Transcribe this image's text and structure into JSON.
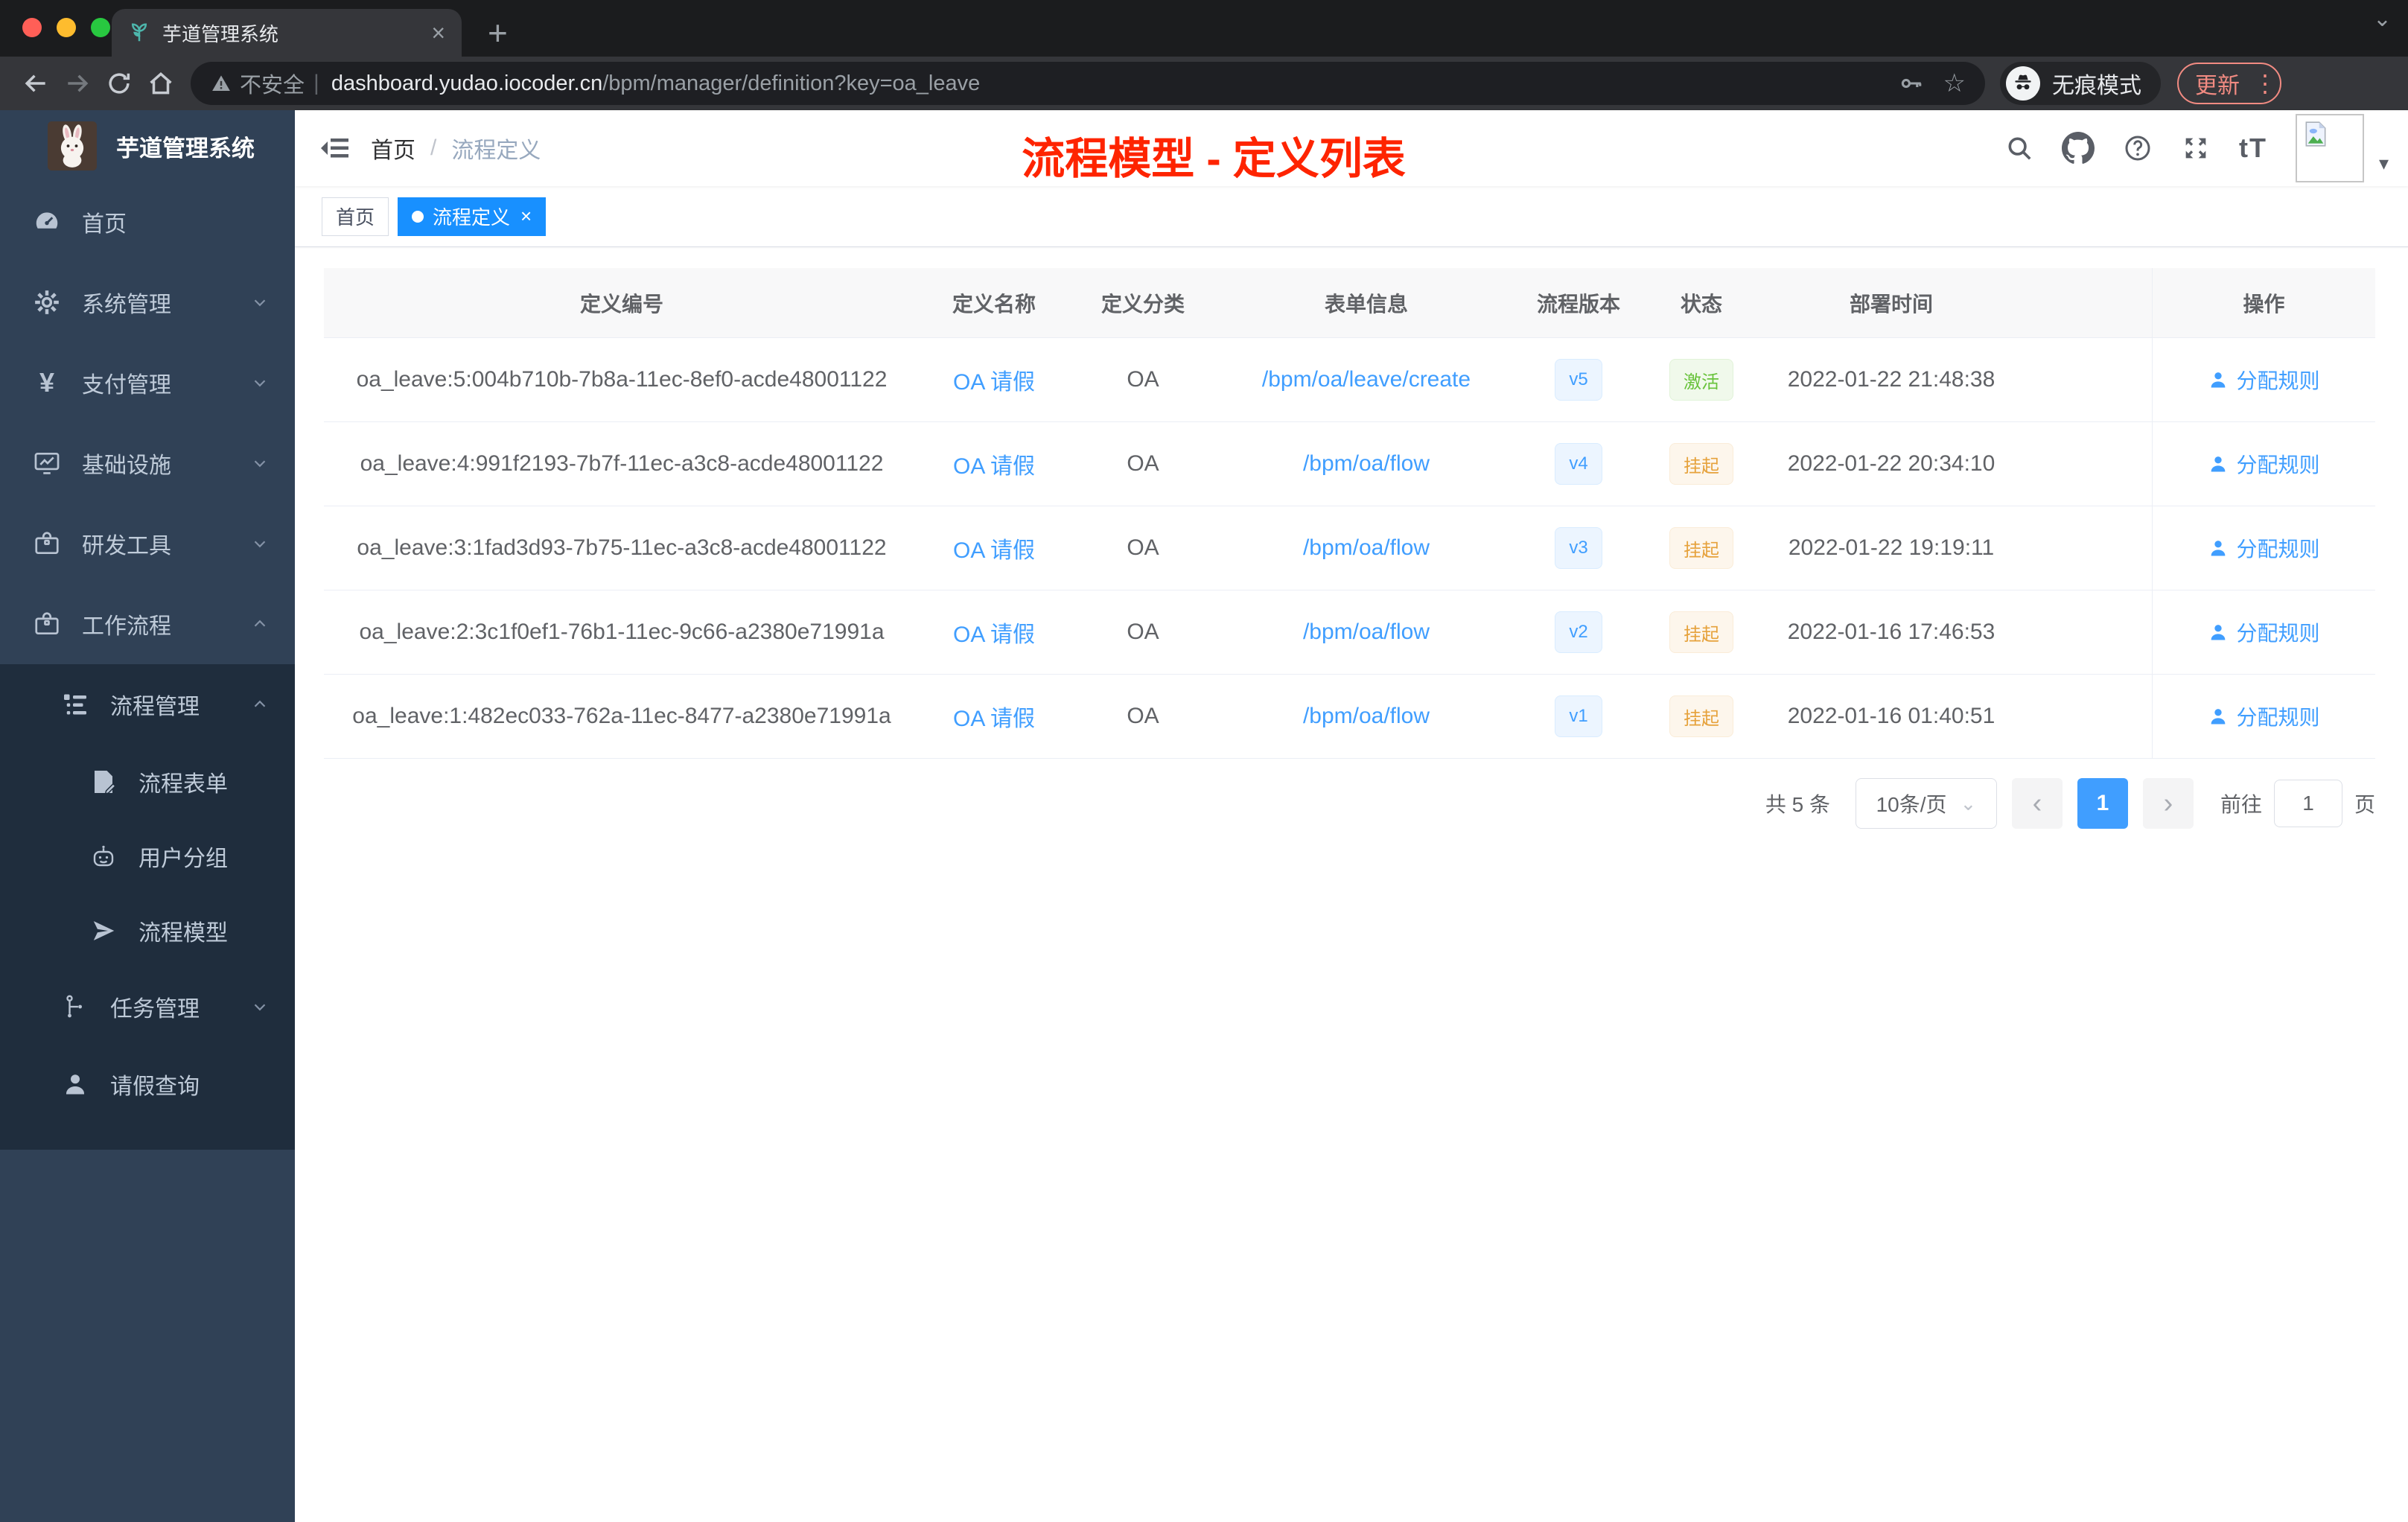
{
  "colors": {
    "primary_blue": "#409eff",
    "tag_active_blue": "#1890ff",
    "success_green": "#67c23a",
    "warning_orange": "#e6a23c",
    "annotation_red": "#fe2400",
    "sidebar_bg": "#304156",
    "submenu_bg": "#1f2d3d"
  },
  "icons": {
    "close_glyph": "×",
    "add_glyph": "+",
    "chevron_glyph": "⌄",
    "star_glyph": "☆",
    "kebab_glyph": "⋮",
    "caret_glyph": "▾",
    "prev_glyph": "‹",
    "next_glyph": "›",
    "divider_glyph": "|",
    "yuan_glyph": "¥",
    "text_size_glyph": "tT"
  },
  "browser": {
    "tab_title": "芋道管理系统",
    "security_label": "不安全",
    "url_host": "dashboard.yudao.iocoder.cn",
    "url_path": "/bpm/manager/definition?key=oa_leave",
    "incognito_label": "无痕模式",
    "update_label": "更新"
  },
  "sidebar": {
    "app_title": "芋道管理系统",
    "items": [
      {
        "label": "首页",
        "icon": "dashboard-icon"
      },
      {
        "label": "系统管理",
        "icon": "gear-icon"
      },
      {
        "label": "支付管理",
        "icon": "yuan-icon"
      },
      {
        "label": "基础设施",
        "icon": "monitor-icon"
      },
      {
        "label": "研发工具",
        "icon": "briefcase-icon"
      },
      {
        "label": "工作流程",
        "icon": "briefcase-icon"
      },
      {
        "label": "流程管理",
        "icon": "list-tree-icon"
      },
      {
        "label": "流程表单",
        "icon": "form-edit-icon"
      },
      {
        "label": "用户分组",
        "icon": "robot-icon"
      },
      {
        "label": "流程模型",
        "icon": "paper-plane-icon"
      },
      {
        "label": "任务管理",
        "icon": "tree-branch-icon"
      },
      {
        "label": "请假查询",
        "icon": "user-icon"
      }
    ]
  },
  "header": {
    "breadcrumb_home": "首页",
    "breadcrumb_separator": "/",
    "breadcrumb_current": "流程定义",
    "annotation": "流程模型 - 定义列表"
  },
  "tags": {
    "home_label": "首页",
    "active_label": "流程定义"
  },
  "table": {
    "columns": [
      "定义编号",
      "定义名称",
      "定义分类",
      "表单信息",
      "流程版本",
      "状态",
      "部署时间",
      "操作"
    ],
    "action_label": "分配规则",
    "rows": [
      {
        "id": "oa_leave:5:004b710b-7b8a-11ec-8ef0-acde48001122",
        "name": "OA 请假",
        "category": "OA",
        "form": "/bpm/oa/leave/create",
        "version": "v5",
        "status": "激活",
        "status_type": "success",
        "time": "2022-01-22 21:48:38"
      },
      {
        "id": "oa_leave:4:991f2193-7b7f-11ec-a3c8-acde48001122",
        "name": "OA 请假",
        "category": "OA",
        "form": "/bpm/oa/flow",
        "version": "v4",
        "status": "挂起",
        "status_type": "warning",
        "time": "2022-01-22 20:34:10"
      },
      {
        "id": "oa_leave:3:1fad3d93-7b75-11ec-a3c8-acde48001122",
        "name": "OA 请假",
        "category": "OA",
        "form": "/bpm/oa/flow",
        "version": "v3",
        "status": "挂起",
        "status_type": "warning",
        "time": "2022-01-22 19:19:11"
      },
      {
        "id": "oa_leave:2:3c1f0ef1-76b1-11ec-9c66-a2380e71991a",
        "name": "OA 请假",
        "category": "OA",
        "form": "/bpm/oa/flow",
        "version": "v2",
        "status": "挂起",
        "status_type": "warning",
        "time": "2022-01-16 17:46:53"
      },
      {
        "id": "oa_leave:1:482ec033-762a-11ec-8477-a2380e71991a",
        "name": "OA 请假",
        "category": "OA",
        "form": "/bpm/oa/flow",
        "version": "v1",
        "status": "挂起",
        "status_type": "warning",
        "time": "2022-01-16 01:40:51"
      }
    ]
  },
  "pagination": {
    "total_label": "共 5 条",
    "page_size_label": "10条/页",
    "current_page": "1",
    "goto_label": "前往",
    "goto_value": "1",
    "page_unit_label": "页"
  }
}
